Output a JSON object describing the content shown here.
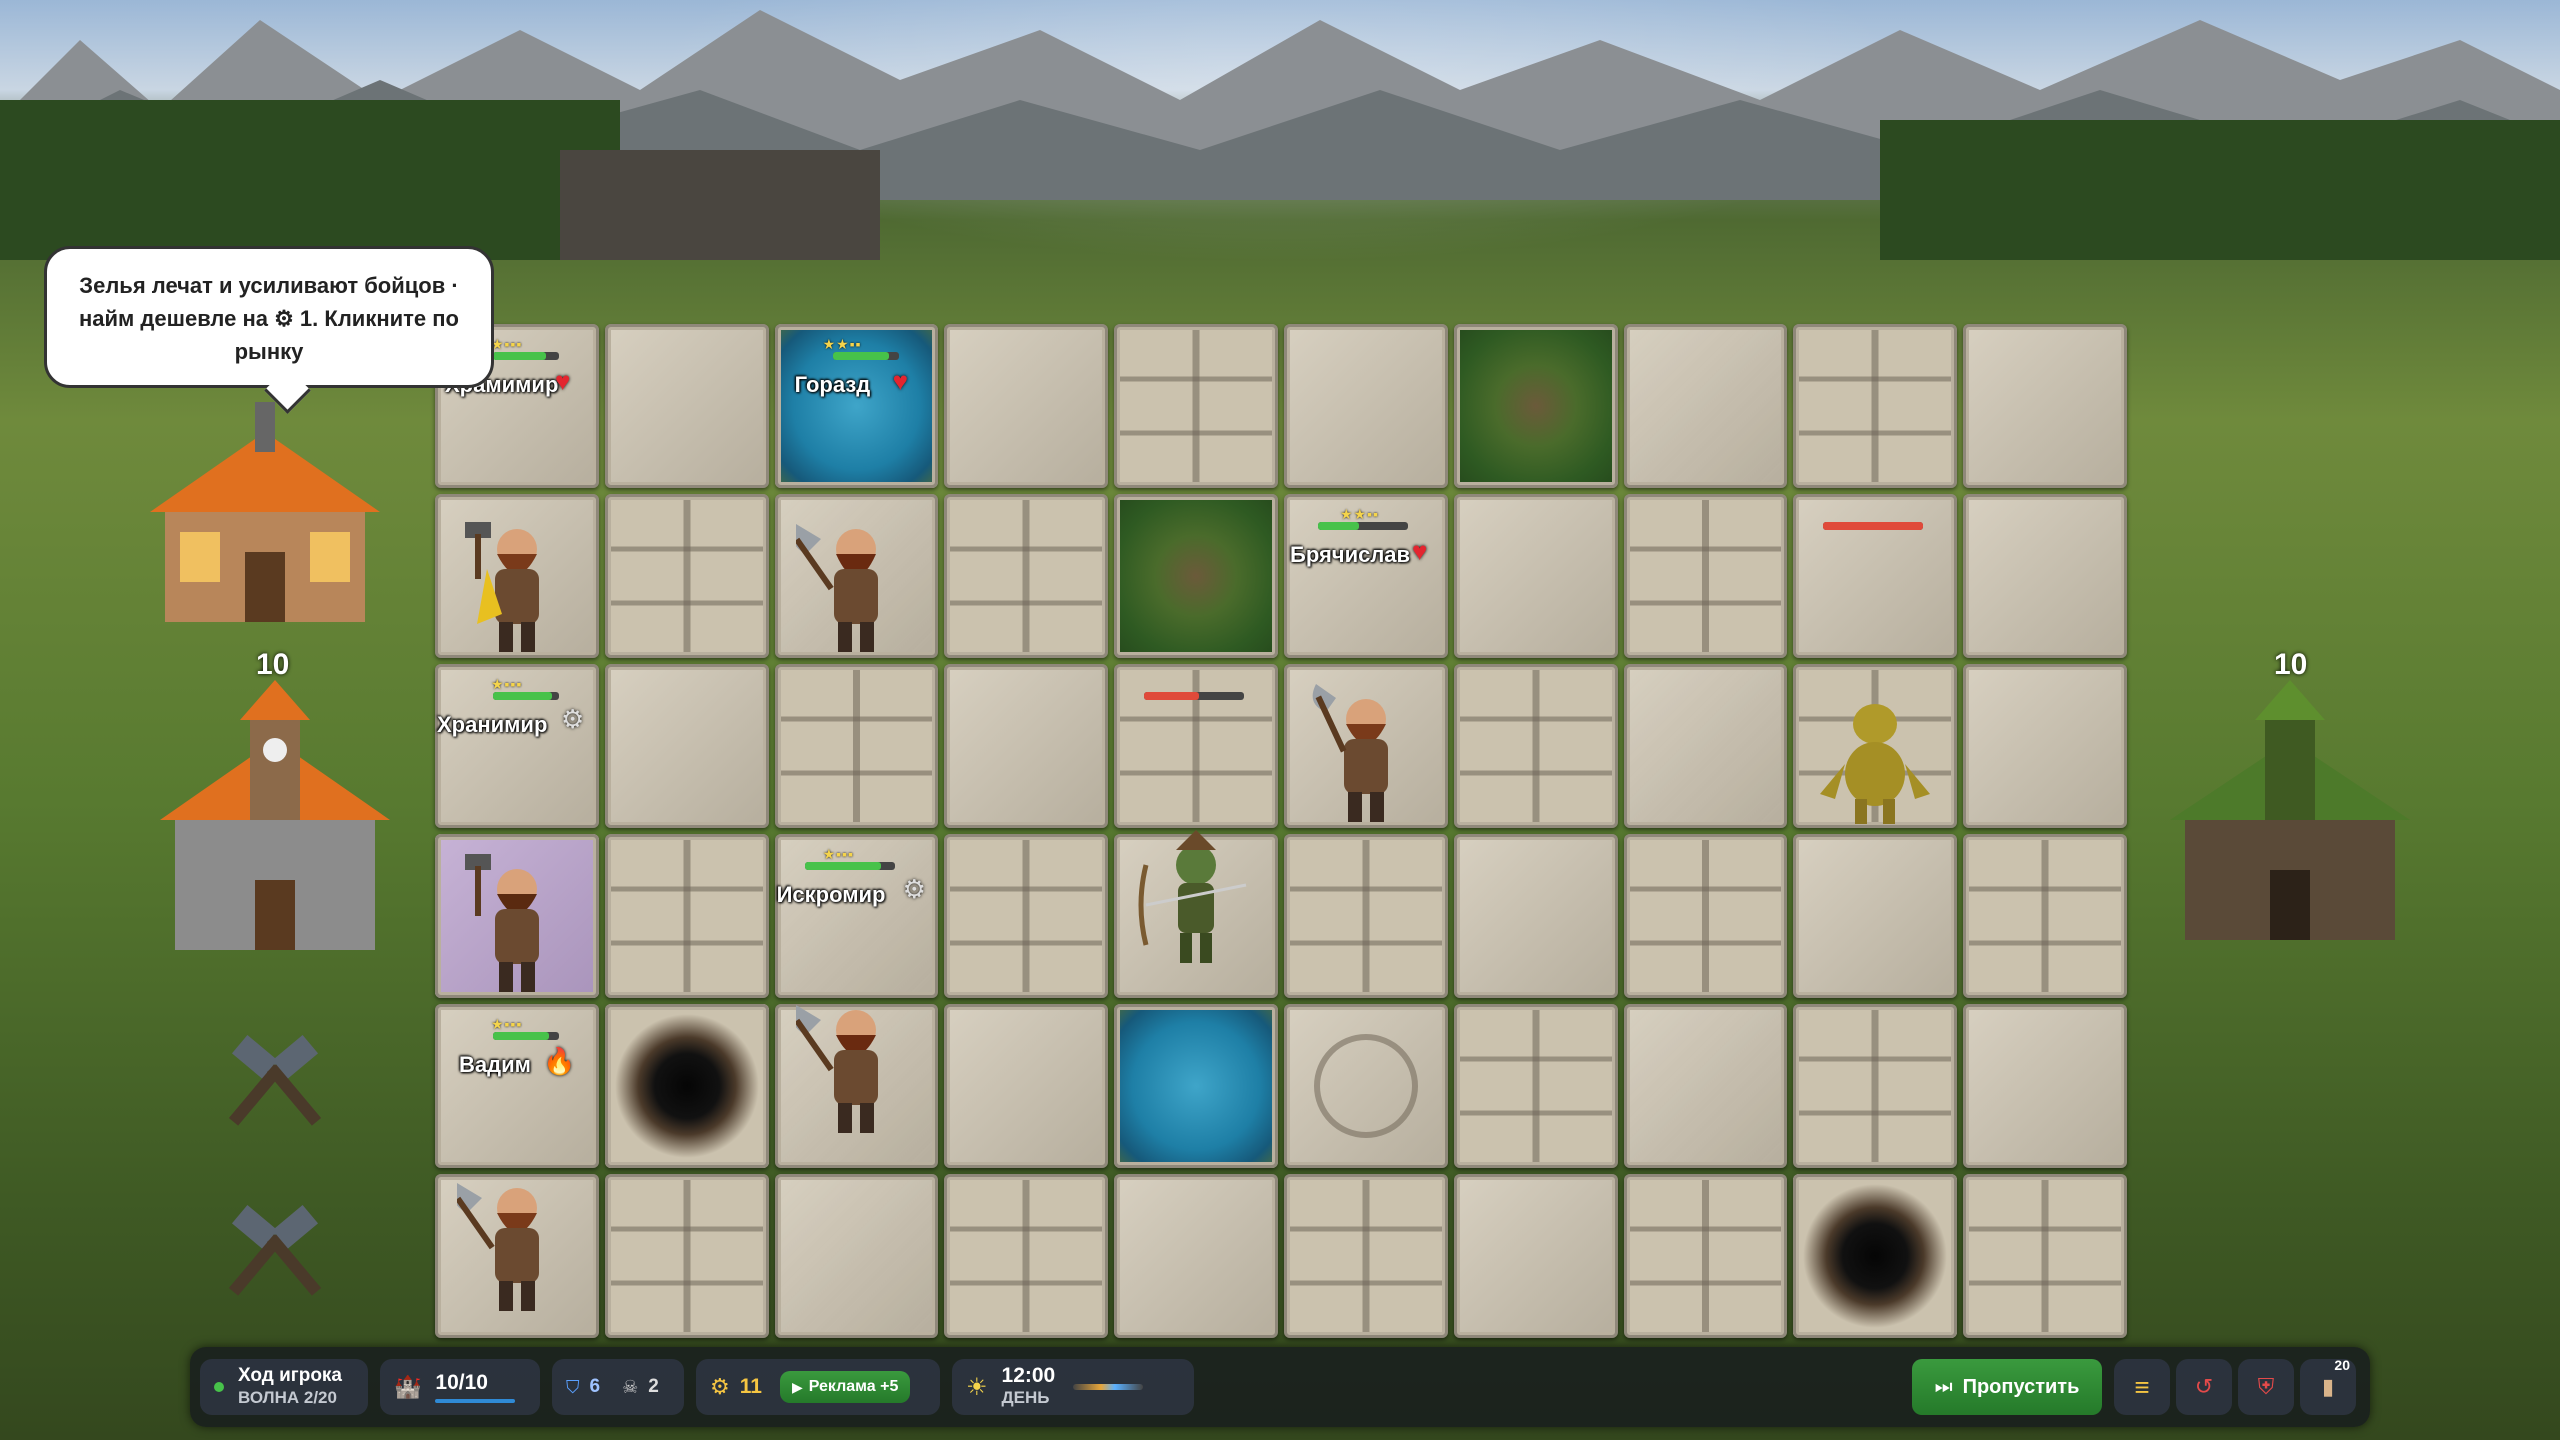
{
  "tutorial": {
    "text": "Зелья лечат и усиливают бойцов · найм дешевле на ⚙ 1. Кликните по рынку"
  },
  "buildings": {
    "player_base_hp": "10",
    "enemy_base_hp": "10"
  },
  "units": [
    {
      "name": "Храмимир",
      "row": 0,
      "col": 0,
      "status": "heart"
    },
    {
      "name": "Горазд",
      "row": 0,
      "col": 2,
      "status": "heart"
    },
    {
      "name": "Брячислав",
      "row": 1,
      "col": 5,
      "status": "heart"
    },
    {
      "name": "Хранимир",
      "row": 2,
      "col": 0,
      "status": "gear"
    },
    {
      "name": "Искромир",
      "row": 3,
      "col": 2,
      "status": "gear"
    },
    {
      "name": "Вадим",
      "row": 4,
      "col": 0,
      "status": "fire"
    }
  ],
  "hud": {
    "turn_title": "Ход игрока",
    "wave": "ВОЛНА 2/20",
    "castle_hp": "10/10",
    "shield_count": "6",
    "skull_count": "2",
    "gold": "11",
    "ad_label": "Реклама +5",
    "time": "12:00",
    "time_label": "ДЕНЬ",
    "skip_label": "Пропустить",
    "deck_count": "20"
  },
  "colors": {
    "accent_green": "#3a9a3e",
    "hp_green": "#47c24a",
    "hp_red": "#e04a3a",
    "gold": "#f5c542"
  }
}
